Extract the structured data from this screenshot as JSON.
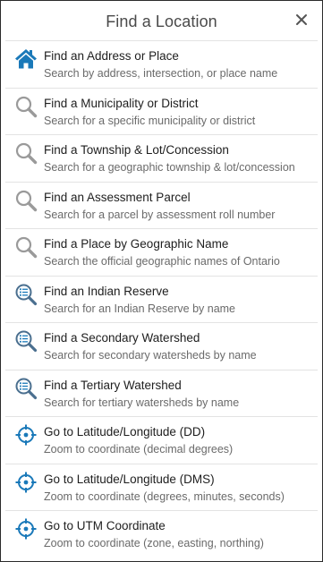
{
  "dialog": {
    "title": "Find a Location"
  },
  "colors": {
    "icon_blue": "#1a79b9",
    "icon_gray": "#9a9a9a",
    "border": "#e3e3e3"
  },
  "items": [
    {
      "label": "Find an Address or Place",
      "desc": "Search by address, intersection, or place name",
      "icon": "home-icon"
    },
    {
      "label": "Find a Municipality or District",
      "desc": "Search for a specific municipality or district",
      "icon": "magnifier-icon"
    },
    {
      "label": "Find a Township & Lot/Concession",
      "desc": "Search for a geographic township & lot/concession",
      "icon": "magnifier-icon"
    },
    {
      "label": "Find an Assessment Parcel",
      "desc": "Search for a parcel by assessment roll number",
      "icon": "magnifier-icon"
    },
    {
      "label": "Find a Place by Geographic Name",
      "desc": "Search the official geographic names of Ontario",
      "icon": "magnifier-icon"
    },
    {
      "label": "Find an Indian Reserve",
      "desc": "Search for an Indian Reserve by name",
      "icon": "list-search-icon"
    },
    {
      "label": "Find a Secondary Watershed",
      "desc": "Search for secondary watersheds by name",
      "icon": "list-search-icon"
    },
    {
      "label": "Find a Tertiary Watershed",
      "desc": "Search for tertiary watersheds by name",
      "icon": "list-search-icon"
    },
    {
      "label": "Go to Latitude/Longitude (DD)",
      "desc": "Zoom to coordinate (decimal degrees)",
      "icon": "crosshair-icon"
    },
    {
      "label": "Go to Latitude/Longitude (DMS)",
      "desc": "Zoom to coordinate (degrees, minutes, seconds)",
      "icon": "crosshair-icon"
    },
    {
      "label": "Go to UTM Coordinate",
      "desc": "Zoom to coordinate (zone, easting, northing)",
      "icon": "crosshair-icon"
    }
  ]
}
